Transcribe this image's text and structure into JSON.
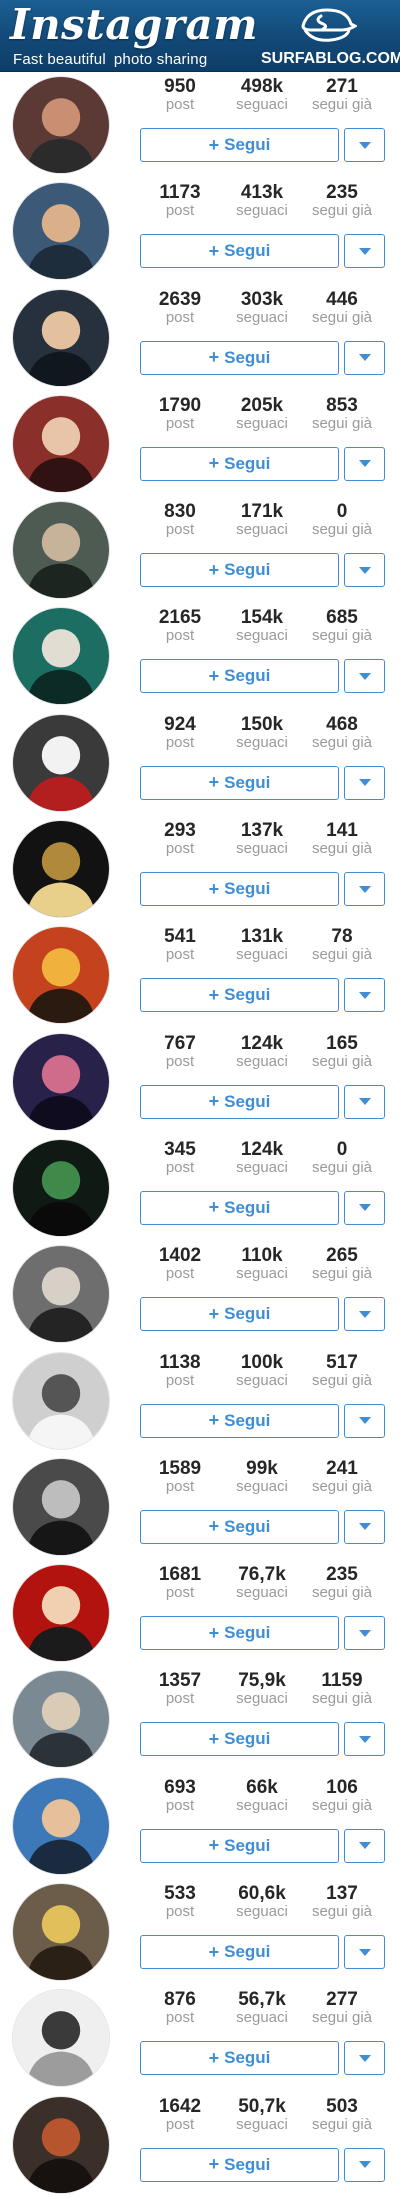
{
  "header": {
    "brand": "Instagram",
    "tagline_left": "Fast beautiful",
    "tagline_right": "photo sharing",
    "site": "SURFABLOG.COM"
  },
  "labels": {
    "posts": "post",
    "followers": "seguaci",
    "following": "segui già",
    "follow": "Segui",
    "follow_plus": "+"
  },
  "icons": {
    "dropdown": "chevron-down-icon",
    "follow": "plus-icon",
    "logo": "surfablog-logo-icon"
  },
  "colors": {
    "header": "#124978",
    "accent": "#3f8ed5",
    "stat_value": "#262626",
    "stat_label": "#9a9a9a"
  },
  "profiles": [
    {
      "posts": "950",
      "followers": "498k",
      "following": "271"
    },
    {
      "posts": "1173",
      "followers": "413k",
      "following": "235"
    },
    {
      "posts": "2639",
      "followers": "303k",
      "following": "446"
    },
    {
      "posts": "1790",
      "followers": "205k",
      "following": "853"
    },
    {
      "posts": "830",
      "followers": "171k",
      "following": "0"
    },
    {
      "posts": "2165",
      "followers": "154k",
      "following": "685"
    },
    {
      "posts": "924",
      "followers": "150k",
      "following": "468"
    },
    {
      "posts": "293",
      "followers": "137k",
      "following": "141"
    },
    {
      "posts": "541",
      "followers": "131k",
      "following": "78"
    },
    {
      "posts": "767",
      "followers": "124k",
      "following": "165"
    },
    {
      "posts": "345",
      "followers": "124k",
      "following": "0"
    },
    {
      "posts": "1402",
      "followers": "110k",
      "following": "265"
    },
    {
      "posts": "1138",
      "followers": "100k",
      "following": "517"
    },
    {
      "posts": "1589",
      "followers": "99k",
      "following": "241"
    },
    {
      "posts": "1681",
      "followers": "76,7k",
      "following": "235"
    },
    {
      "posts": "1357",
      "followers": "75,9k",
      "following": "1159"
    },
    {
      "posts": "693",
      "followers": "66k",
      "following": "106"
    },
    {
      "posts": "533",
      "followers": "60,6k",
      "following": "137"
    },
    {
      "posts": "876",
      "followers": "56,7k",
      "following": "277"
    },
    {
      "posts": "1642",
      "followers": "50,7k",
      "following": "503"
    }
  ]
}
